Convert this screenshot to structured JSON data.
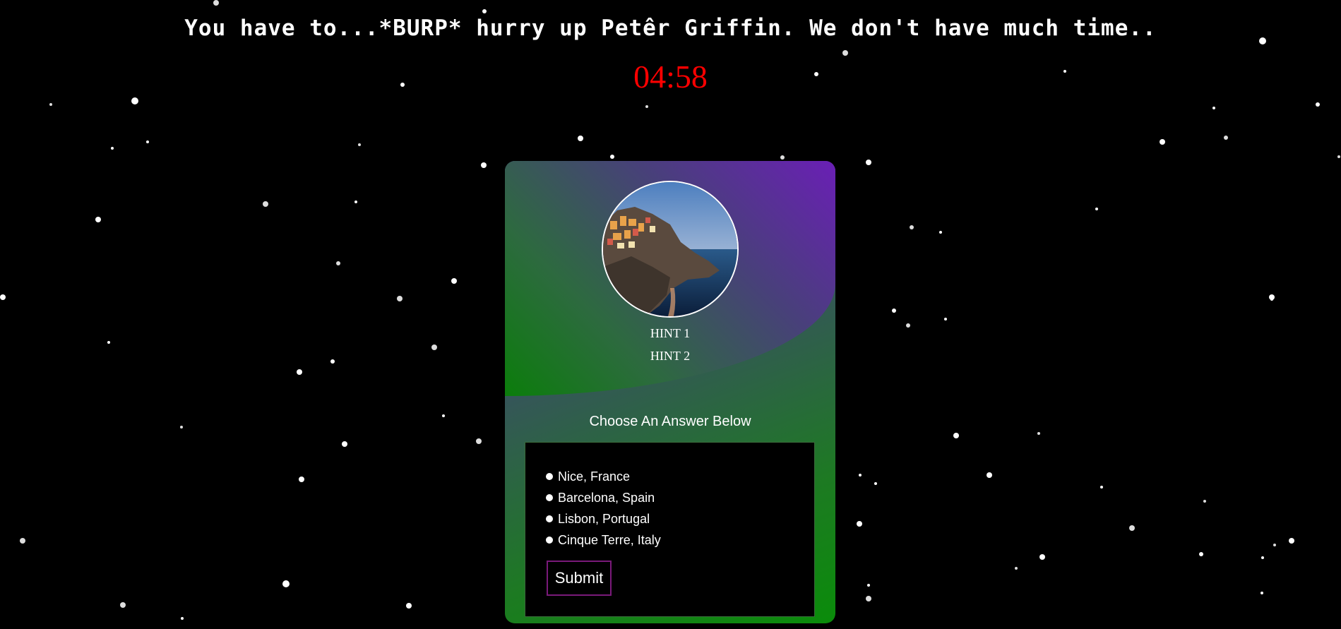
{
  "header": {
    "message": "You have to...*BURP* hurry up Petêr Griffin. We don't have much time..",
    "timer": "04:58"
  },
  "quiz": {
    "image": {
      "description_icon": "coastal-village-photo"
    },
    "hints": [
      "HINT 1",
      "HINT 2"
    ],
    "prompt": "Choose An Answer Below",
    "options": [
      "Nice, France",
      "Barcelona, Spain",
      "Lisbon, Portugal",
      "Cinque Terre, Italy"
    ],
    "submit_label": "Submit"
  },
  "colors": {
    "background": "#000000",
    "timer": "#ff0000",
    "submit_border": "#7a1a7a",
    "gradient_purple": "#6a1fb5",
    "gradient_green": "#0a8c0a"
  }
}
